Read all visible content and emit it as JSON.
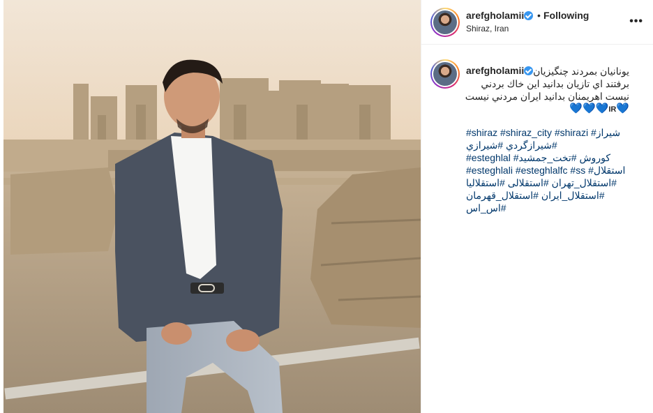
{
  "header": {
    "username": "arefgholamii",
    "dot": "•",
    "follow_status": "Following",
    "location": "Shiraz, Iran",
    "more_glyph": "•••"
  },
  "caption": {
    "username": "arefgholamii",
    "lines": [
      "يونانيان بمردند چنگيزيان",
      "برفتند اي تازيان بدانيد اين خاك بردني",
      "نيست اهريمنان بدانيد ايران مردني نيست"
    ],
    "emoji_line": {
      "heart_left": "💙",
      "flag": "IR",
      "hearts_right": "💙💙💙"
    },
    "hashtags": [
      "#shiraz #shiraz_city #shirazi #شيراز",
      "#شيرازگردي #شيرازي",
      "#esteghlal #كوروش #تخت_جمشيد",
      "#esteghlali #esteghlalfc #ss #استقلال",
      "#استقلال_تهران #استقلالی #استقلاليا",
      "#استقلال_ايران #استقلال_قهرمان",
      "#اس_اس"
    ]
  },
  "colors": {
    "verified": "#3897f0",
    "hashtag": "#00376b",
    "heart": "#1a73c8"
  },
  "icons": {
    "verified": "verified-badge-icon",
    "more": "more-options-icon"
  }
}
